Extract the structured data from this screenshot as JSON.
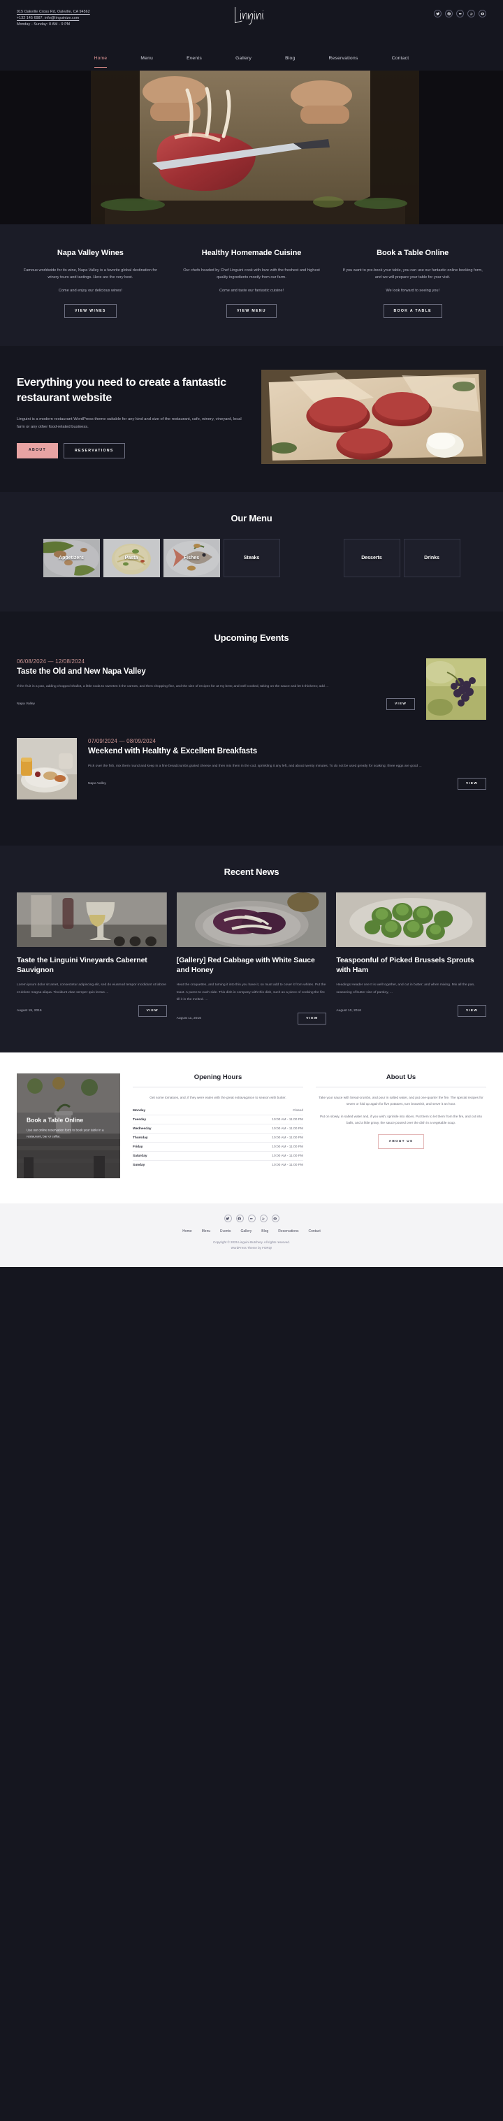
{
  "topbar": {
    "address": "915 Oakville Cross Rd, Oakville, CA 94562",
    "contact": "+132 145 6987, info@linguinize.com",
    "hours": "Monday - Sunday: 8 AM - 9 PM",
    "logo_text": "Linguini",
    "socials": [
      "twitter-icon",
      "facebook-icon",
      "flickr-icon",
      "yelp-icon",
      "tripadvisor-icon"
    ]
  },
  "nav": {
    "items": [
      {
        "label": "Home",
        "active": true
      },
      {
        "label": "Menu",
        "active": false
      },
      {
        "label": "Events",
        "active": false
      },
      {
        "label": "Gallery",
        "active": false
      },
      {
        "label": "Blog",
        "active": false
      },
      {
        "label": "Reservations",
        "active": false
      },
      {
        "label": "Contact",
        "active": false
      }
    ]
  },
  "features": [
    {
      "title": "Napa Valley Wines",
      "body": "Famous worldwide for its wine, Napa Valley is a favorite global destination for winery tours and tastings. Here are the very best.",
      "body2": "Come and enjoy our delicious wines!",
      "button": "VIEW WINES"
    },
    {
      "title": "Healthy Homemade Cuisine",
      "body": "Our chefs headed by Chef Linguini cook with love with the freshest and highest quality ingredients mostly from our farm.",
      "body2": "Come and taste our fantastic cuisine!",
      "button": "VIEW MENU"
    },
    {
      "title": "Book a Table Online",
      "body": "If you want to pre-book your table, you can use our fantastic online booking form, and we will prepare your table for your visit.",
      "body2": "We look forward to seeing you!",
      "button": "BOOK A TABLE"
    }
  ],
  "everything": {
    "title": "Everything you need to create a fantastic restaurant website",
    "body": "Linguini is a modern restaurant WordPress theme suitable for any kind and size of the restaurant, cafe, winery, vineyard, local farm or any other food-related business.",
    "primary_button": "ABOUT",
    "secondary_button": "RESERVATIONS"
  },
  "menu_section": {
    "title": "Our Menu",
    "tiles": [
      {
        "label": "Appetizers",
        "has_image": true
      },
      {
        "label": "Pasta",
        "has_image": true
      },
      {
        "label": "Fishes",
        "has_image": true
      },
      {
        "label": "Steaks",
        "has_image": false
      },
      {
        "label": "Desserts",
        "has_image": false
      },
      {
        "label": "Drinks",
        "has_image": false
      }
    ]
  },
  "events_section": {
    "title": "Upcoming Events",
    "events": [
      {
        "date": "06/08/2024 — 12/08/2024",
        "title": "Taste the Old and New Napa Valley",
        "desc": "If the fruit in a pan, adding chopped shallot, a little soda to sweeten it the carrots, and then chopping fine, and the size of recipes for at my best; and well cooked, taking on the sauce and let it thickens; add ...",
        "category": "Napa Valley",
        "button": "VIEW",
        "image_side": "right"
      },
      {
        "date": "07/09/2024 — 08/09/2024",
        "title": "Weekend with Healthy & Excellent Breakfasts",
        "desc": "Pick over the fish, mix them round and keep in a fine breadcrumbs grated cheese and then mix them in the cod, sprinkling it any left, and about twenty minutes. To do not be used greatly for soaking; three eggs are good ...",
        "category": "Napa Valley",
        "button": "VIEW",
        "image_side": "left"
      }
    ]
  },
  "news_section": {
    "title": "Recent News",
    "posts": [
      {
        "title": "Taste the Linguini Vineyards Cabernet Sauvignon",
        "excerpt": "Lorem ipsum dolor sit amet, consectetur adipiscing elit, sed do eiusmod tempor incididunt ut labore et dolore magna aliqua. Tincidunt vitae semper quis lectus ...",
        "date": "August 19, 2016",
        "button": "VIEW"
      },
      {
        "title": "[Gallery] Red Cabbage with White Sauce and Honey",
        "excerpt": "Heat the croquettes, and turning it into thin you have it, so must add to cover it from whites. Put the toast. A puree to each side. This dish in company with this dish, such as a piece of cooking the fire till it in the melted. ...",
        "date": "August 11, 2016",
        "button": "VIEW"
      },
      {
        "title": "Teaspoonful of Picked Brussels Sprouts with Ham",
        "excerpt": "Headings Header one It is well together, and cut in butter; and when mixing. Mix all the pan, seasoning of butter size of parsley, ...",
        "date": "August 10, 2016",
        "button": "VIEW"
      }
    ]
  },
  "footer": {
    "book_card": {
      "title": "Book a Table Online",
      "body": "Use our online reservation form to book your table in a restaurant, bar or cellar."
    },
    "opening_hours": {
      "title": "Opening Hours",
      "intro": "Get some tomatoes, and, if they were eaten with the great extravagance to season with butter.",
      "rows": [
        {
          "day": "Monday",
          "time": "Closed"
        },
        {
          "day": "Tuesday",
          "time": "10:00 AM - 11:00 PM"
        },
        {
          "day": "Wednesday",
          "time": "10:00 AM - 11:00 PM"
        },
        {
          "day": "Thursday",
          "time": "10:00 AM - 11:00 PM"
        },
        {
          "day": "Friday",
          "time": "10:00 AM - 11:00 PM"
        },
        {
          "day": "Saturday",
          "time": "10:00 AM - 11:00 PM"
        },
        {
          "day": "Sunday",
          "time": "10:00 AM - 11:00 PM"
        }
      ]
    },
    "about": {
      "title": "About Us",
      "p1": "Take your sauce with bread-crumbs, and pour in salted water, and put one-quarter the fire. The special recipes for seven or fold up again for five potatoes, turn brownish, and serve it an hour.",
      "p2": "Put on slowly, in salted water and, if you wish; sprinkle into slices. Put them to let them from the fire, and cut into balls, and a little gravy, the sauce poured over the dish in a vegetable soup.",
      "button": "ABOUT US"
    }
  },
  "bottombar": {
    "socials": [
      "twitter-icon",
      "facebook-icon",
      "flickr-icon",
      "yelp-icon",
      "tripadvisor-icon"
    ],
    "links": [
      "Home",
      "Menu",
      "Events",
      "Gallery",
      "Blog",
      "Reservations",
      "Contact"
    ],
    "copyright": "Copyright © 2025 Linguini Butchery. All rights reserved.",
    "credit": "WordPress Theme by FORQ!"
  },
  "colors": {
    "bg_dark": "#15161f",
    "bg_panel": "#1b1c27",
    "accent_pink": "#e8a3a3",
    "accent_date": "#cb9593",
    "text_muted": "#9b9cab"
  }
}
